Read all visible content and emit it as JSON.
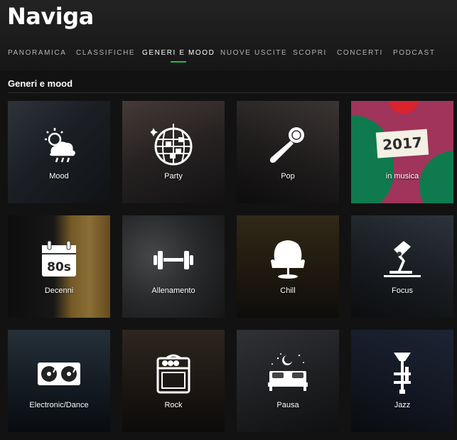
{
  "header": {
    "title": "Naviga"
  },
  "tabs": [
    {
      "label": "PANORAMICA"
    },
    {
      "label": "CLASSIFICHE"
    },
    {
      "label": "GENERI E MOOD"
    },
    {
      "label": "NUOVE USCITE"
    },
    {
      "label": "SCOPRI"
    },
    {
      "label": "CONCERTI"
    },
    {
      "label": "PODCAST"
    }
  ],
  "active_tab": "GENERI E MOOD",
  "section": {
    "title": "Generi e mood"
  },
  "tiles": [
    {
      "label": "Mood",
      "icon": "weather-icon"
    },
    {
      "label": "Party",
      "icon": "disco-ball-icon"
    },
    {
      "label": "Pop",
      "icon": "microphone-icon"
    },
    {
      "label": "in musica",
      "badge": "2017"
    },
    {
      "label": "Decenni",
      "icon": "calendar-80s-icon",
      "icon_text": "80s"
    },
    {
      "label": "Allenamento",
      "icon": "dumbbell-icon"
    },
    {
      "label": "Chill",
      "icon": "egg-chair-icon"
    },
    {
      "label": "Focus",
      "icon": "desk-lamp-icon"
    },
    {
      "label": "Electronic/Dance",
      "icon": "turntables-icon"
    },
    {
      "label": "Rock",
      "icon": "amplifier-icon"
    },
    {
      "label": "Pausa",
      "icon": "bed-icon"
    },
    {
      "label": "Jazz",
      "icon": "trumpet-icon"
    }
  ],
  "colors": {
    "accent": "#1db954",
    "background": "#121212"
  }
}
